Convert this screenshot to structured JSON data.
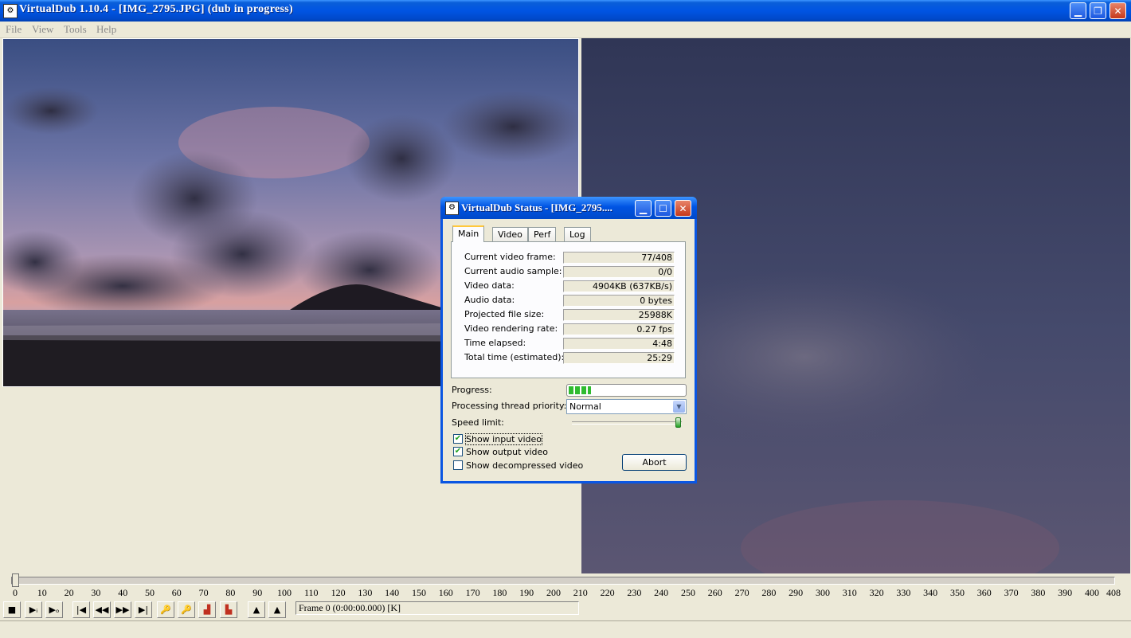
{
  "window": {
    "title": "VirtualDub 1.10.4 - [IMG_2795.JPG] (dub in progress)",
    "min_icon": "minimize-icon",
    "restore_icon": "restore-icon",
    "close_icon": "close-icon"
  },
  "menu": {
    "items": [
      {
        "label": "File",
        "mnemonic": "F"
      },
      {
        "label": "View",
        "mnemonic": "V"
      },
      {
        "label": "Tools",
        "mnemonic": "T"
      },
      {
        "label": "Help",
        "mnemonic": "H"
      }
    ]
  },
  "status_dialog": {
    "title": "VirtualDub Status - [IMG_2795....",
    "tabs": [
      "Main",
      "Video",
      "Perf",
      "Log"
    ],
    "active_tab": "Main",
    "stats": [
      {
        "label": "Current video frame:",
        "value": "77/408"
      },
      {
        "label": "Current audio sample:",
        "value": "0/0"
      },
      {
        "label": "Video data:",
        "value": "4904KB (637KB/s)"
      },
      {
        "label": "Audio data:",
        "value": "0 bytes"
      },
      {
        "label": "Projected file size:",
        "value": "25988K"
      },
      {
        "label": "Video rendering rate:",
        "value": "0.27 fps"
      },
      {
        "label": "Time elapsed:",
        "value": "4:48"
      },
      {
        "label": "Total time (estimated):",
        "value": "25:29"
      }
    ],
    "progress_label": "Progress:",
    "progress_fraction": 0.19,
    "priority_label": "Processing thread priority:",
    "priority_value": "Normal",
    "speed_label": "Speed limit:",
    "speed_fraction": 1.0,
    "checkboxes": [
      {
        "label": "Show input video",
        "checked": true
      },
      {
        "label": "Show output video",
        "checked": true
      },
      {
        "label": "Show decompressed video",
        "checked": false
      }
    ],
    "abort_label": "Abort",
    "accent": "#21a121"
  },
  "timeline": {
    "position": 0,
    "max": 408,
    "tick_labels": [
      "0",
      "10",
      "20",
      "30",
      "40",
      "50",
      "60",
      "70",
      "80",
      "90",
      "100",
      "110",
      "120",
      "130",
      "140",
      "150",
      "160",
      "170",
      "180",
      "190",
      "200",
      "210",
      "220",
      "230",
      "240",
      "250",
      "260",
      "270",
      "280",
      "290",
      "300",
      "310",
      "320",
      "330",
      "340",
      "350",
      "360",
      "370",
      "380",
      "390",
      "400",
      "408"
    ],
    "frame_status": "Frame 0 (0:00:00.000) [K]"
  },
  "toolbar": {
    "buttons": [
      "stop-icon",
      "play-input-icon",
      "play-output-icon",
      "go-start-icon",
      "prev-frame-icon",
      "next-frame-icon",
      "go-end-icon",
      "prev-keyframe-icon",
      "next-keyframe-icon",
      "prev-scene-icon",
      "next-scene-icon",
      "mark-in-icon",
      "mark-out-icon"
    ]
  }
}
